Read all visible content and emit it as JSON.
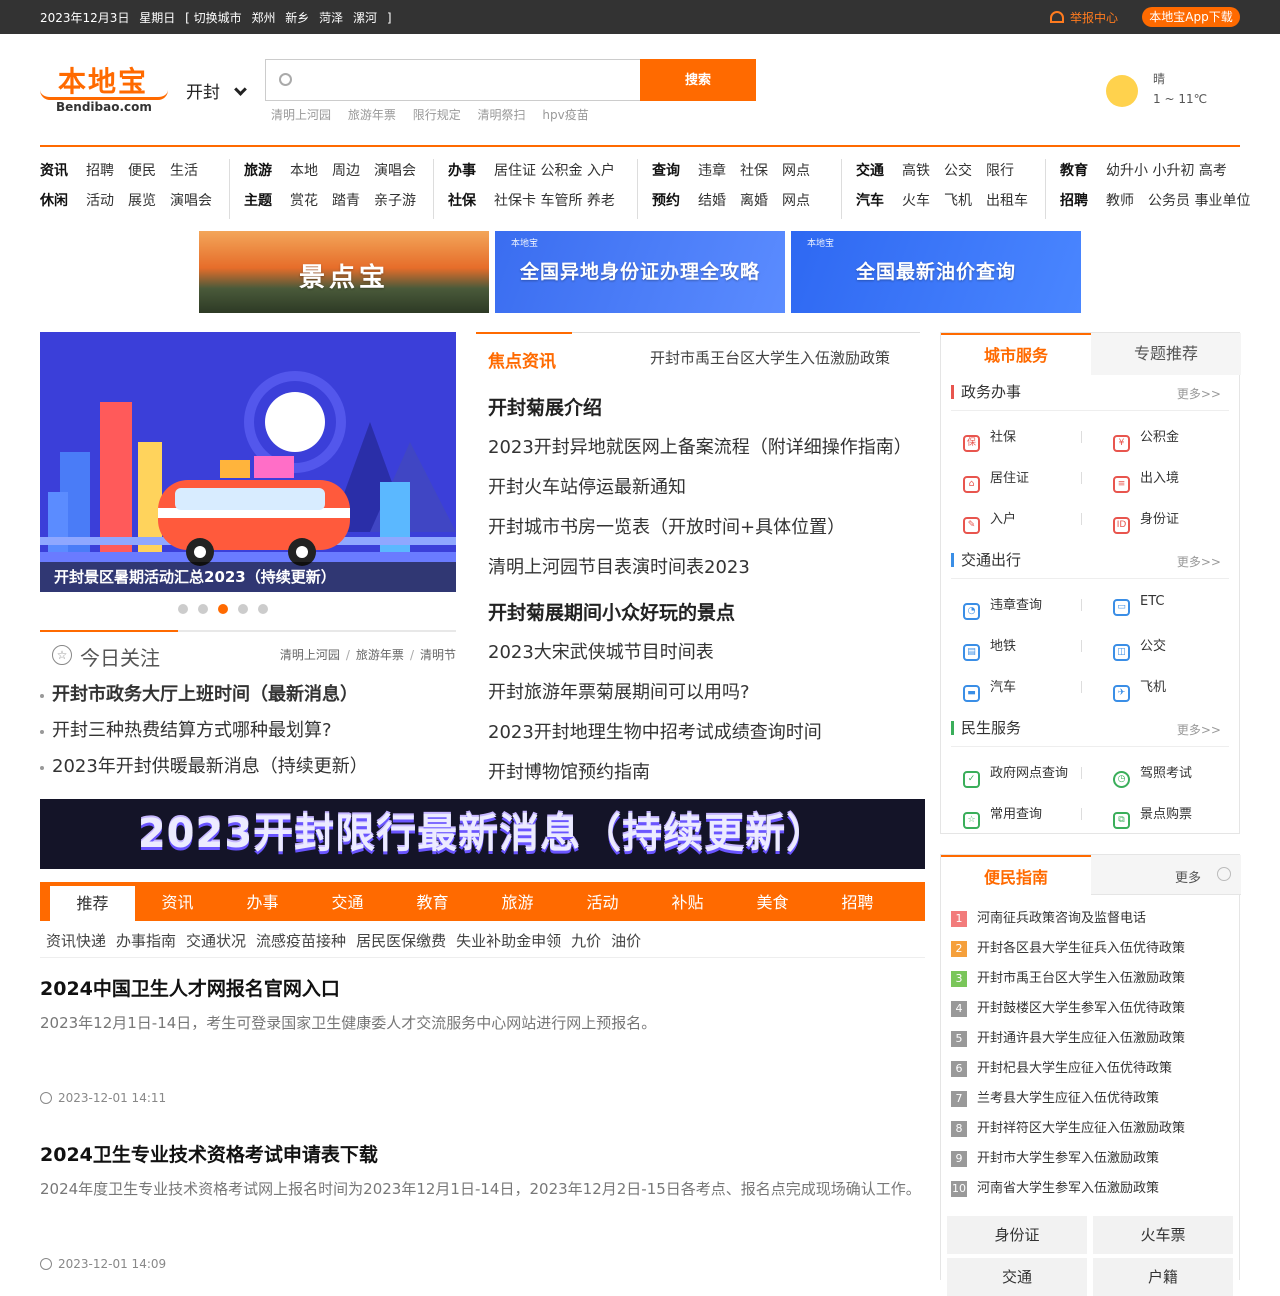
{
  "topbar": {
    "date": "2023年12月3日",
    "weekday": "星期日",
    "switch_label": "[ 切换城市",
    "cities": [
      "郑州",
      "新乡",
      "菏泽",
      "漯河"
    ],
    "close_bracket": "]",
    "report": "举报中心",
    "app_download": "本地宝App下载"
  },
  "logo": {
    "cn": "本地宝",
    "en": "Bendibao.com"
  },
  "city": "开封",
  "search": {
    "placeholder": "",
    "button": "搜索"
  },
  "hot_keywords": [
    "清明上河园",
    "旅游年票",
    "限行规定",
    "清明祭扫",
    "hpv疫苗"
  ],
  "weather": {
    "condition": "晴",
    "temp": "1 ~ 11℃"
  },
  "nav": [
    {
      "rows": [
        [
          "资讯",
          "招聘",
          "便民",
          "生活"
        ],
        [
          "休闲",
          "活动",
          "展览",
          "演唱会"
        ]
      ]
    },
    {
      "rows": [
        [
          "旅游",
          "本地",
          "周边",
          "演唱会"
        ],
        [
          "主题",
          "赏花",
          "踏青",
          "亲子游"
        ]
      ]
    },
    {
      "rows": [
        [
          "办事",
          "居住证 公积金 入户"
        ],
        [
          "社保",
          "社保卡 车管所 养老"
        ]
      ]
    },
    {
      "rows": [
        [
          "查询",
          "违章",
          "社保",
          "网点"
        ],
        [
          "预约",
          "结婚",
          "离婚",
          "网点"
        ]
      ]
    },
    {
      "rows": [
        [
          "交通",
          "高铁",
          "公交",
          "限行"
        ],
        [
          "汽车",
          "火车",
          "飞机",
          "出租车"
        ]
      ]
    },
    {
      "rows": [
        [
          "教育",
          "幼升小 小升初 高考"
        ],
        [
          "招聘",
          "教师",
          "公务员 事业单位"
        ]
      ]
    }
  ],
  "banners": [
    {
      "text": "景点宝",
      "small": ""
    },
    {
      "text": "全国异地身份证办理全攻略",
      "small": "本地宝"
    },
    {
      "text": "全国最新油价查询",
      "small": "本地宝"
    }
  ],
  "slider": {
    "caption": "开封景区暑期活动汇总2023（持续更新）",
    "dots": 5,
    "active": 3
  },
  "today": {
    "title": "今日关注",
    "tags": [
      "清明上河园",
      "旅游年票",
      "清明节"
    ],
    "items": [
      "开封市政务大厅上班时间（最新消息）",
      "开封三种热费结算方式哪种最划算?",
      "2023年开封供暖最新消息（持续更新）"
    ]
  },
  "focus": {
    "title": "焦点资讯",
    "marquee": "开封市禹王台区大学生入伍激励政策",
    "items": [
      {
        "text": "开封菊展介绍",
        "bold": true
      },
      {
        "text": "2023开封异地就医网上备案流程（附详细操作指南）",
        "bold": false
      },
      {
        "text": "开封火车站停运最新通知",
        "bold": false
      },
      {
        "text": "开封城市书房一览表（开放时间+具体位置）",
        "bold": false
      },
      {
        "text": "清明上河园节目表演时间表2023",
        "bold": false
      },
      {
        "text": "开封菊展期间小众好玩的景点",
        "bold": true
      },
      {
        "text": "2023大宋武侠城节目时间表",
        "bold": false
      },
      {
        "text": "开封旅游年票菊展期间可以用吗?",
        "bold": false
      },
      {
        "text": "2023开封地理生物中招考试成绩查询时间",
        "bold": false
      },
      {
        "text": "开封博物馆预约指南",
        "bold": false
      }
    ]
  },
  "wide_banner": "2023开封限行最新消息（持续更新）",
  "tabs": [
    "推荐",
    "资讯",
    "办事",
    "交通",
    "教育",
    "旅游",
    "活动",
    "补贴",
    "美食",
    "招聘"
  ],
  "subtabs": [
    "资讯快递",
    "办事指南",
    "交通状况",
    "流感疫苗接种",
    "居民医保缴费",
    "失业补助金申领",
    "九价",
    "油价"
  ],
  "articles": [
    {
      "title": "2024中国卫生人才网报名官网入口",
      "desc": "2023年12月1日-14日，考生可登录国家卫生健康委人才交流服务中心网站进行网上预报名。",
      "time": "2023-12-01 14:11"
    },
    {
      "title": "2024卫生专业技术资格考试申请表下载",
      "desc": "2024年度卫生专业技术资格考试网上报名时间为2023年12月1日-14日，2023年12月2日-15日各考点、报名点完成现场确认工作。",
      "time": "2023-12-01 14:09"
    }
  ],
  "city_service": {
    "tabs": [
      "城市服务",
      "专题推荐"
    ],
    "sections": [
      {
        "title": "政务办事",
        "more": "更多>>",
        "color": "#e8554e",
        "items": [
          {
            "label": "社保",
            "icon": "shield-icon"
          },
          {
            "label": "公积金",
            "icon": "house-fund-icon"
          },
          {
            "label": "居住证",
            "icon": "home-icon"
          },
          {
            "label": "出入境",
            "icon": "passport-icon"
          },
          {
            "label": "入户",
            "icon": "document-icon"
          },
          {
            "label": "身份证",
            "icon": "id-card-icon"
          }
        ]
      },
      {
        "title": "交通出行",
        "more": "更多>>",
        "color": "#3a8ee6",
        "items": [
          {
            "label": "违章查询",
            "icon": "speedometer-icon"
          },
          {
            "label": "ETC",
            "icon": "etc-card-icon"
          },
          {
            "label": "地铁",
            "icon": "subway-icon"
          },
          {
            "label": "公交",
            "icon": "bus-icon"
          },
          {
            "label": "汽车",
            "icon": "coach-icon"
          },
          {
            "label": "飞机",
            "icon": "plane-icon"
          }
        ]
      },
      {
        "title": "民生服务",
        "more": "更多>>",
        "color": "#3aae5a",
        "items": [
          {
            "label": "政府网点查询",
            "icon": "checklist-icon"
          },
          {
            "label": "驾照考试",
            "icon": "clock-icon"
          },
          {
            "label": "常用查询",
            "icon": "star-icon"
          },
          {
            "label": "景点购票",
            "icon": "ticket-icon"
          }
        ]
      }
    ]
  },
  "guide": {
    "title": "便民指南",
    "more": "更多",
    "items": [
      "河南征兵政策咨询及监督电话",
      "开封各区县大学生征兵入伍优待政策",
      "开封市禹王台区大学生入伍激励政策",
      "开封鼓楼区大学生参军入伍优待政策",
      "开封通许县大学生应征入伍激励政策",
      "开封杞县大学生应征入伍优待政策",
      "兰考县大学生应征入伍优待政策",
      "开封祥符区大学生应征入伍激励政策",
      "开封市大学生参军入伍激励政策",
      "河南省大学生参军入伍激励政策"
    ],
    "buttons": [
      "身份证",
      "火车票",
      "交通",
      "户籍"
    ]
  },
  "colors": {
    "accent": "#ff6a00",
    "num_colors": [
      "#f27b7b",
      "#f5a03c",
      "#7ac65a",
      "#999999"
    ]
  }
}
